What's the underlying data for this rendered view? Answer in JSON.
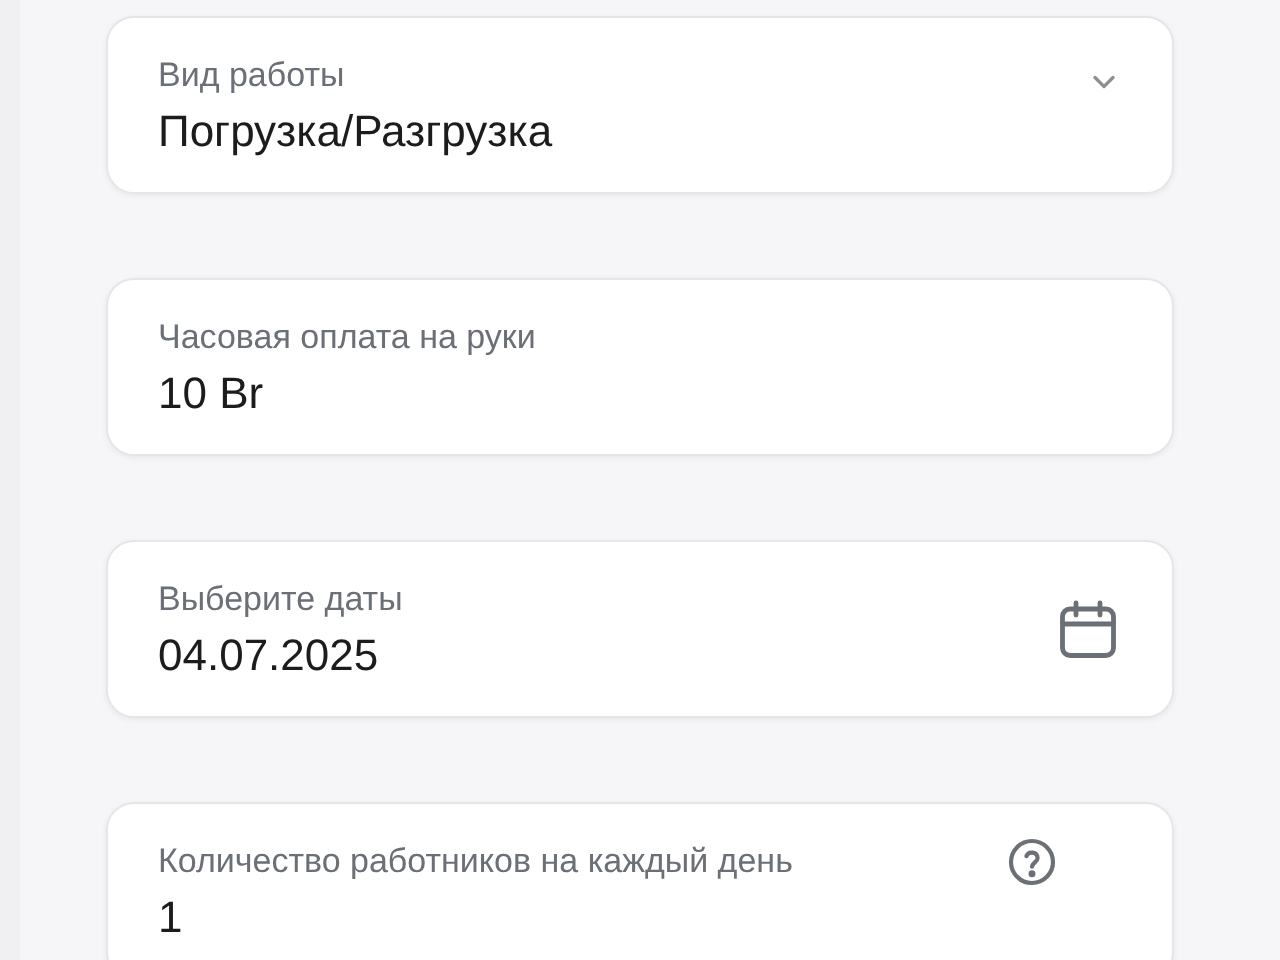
{
  "fields": [
    {
      "kind": "select",
      "label": "Вид работы",
      "value": "Погрузка/Разгрузка"
    },
    {
      "kind": "text",
      "label": "Часовая оплата на руки",
      "value": "10 Br"
    },
    {
      "kind": "date",
      "label": "Выберите даты",
      "value": "04.07.2025"
    },
    {
      "kind": "help",
      "label": "Количество работников на каждый день",
      "value": "1"
    }
  ]
}
